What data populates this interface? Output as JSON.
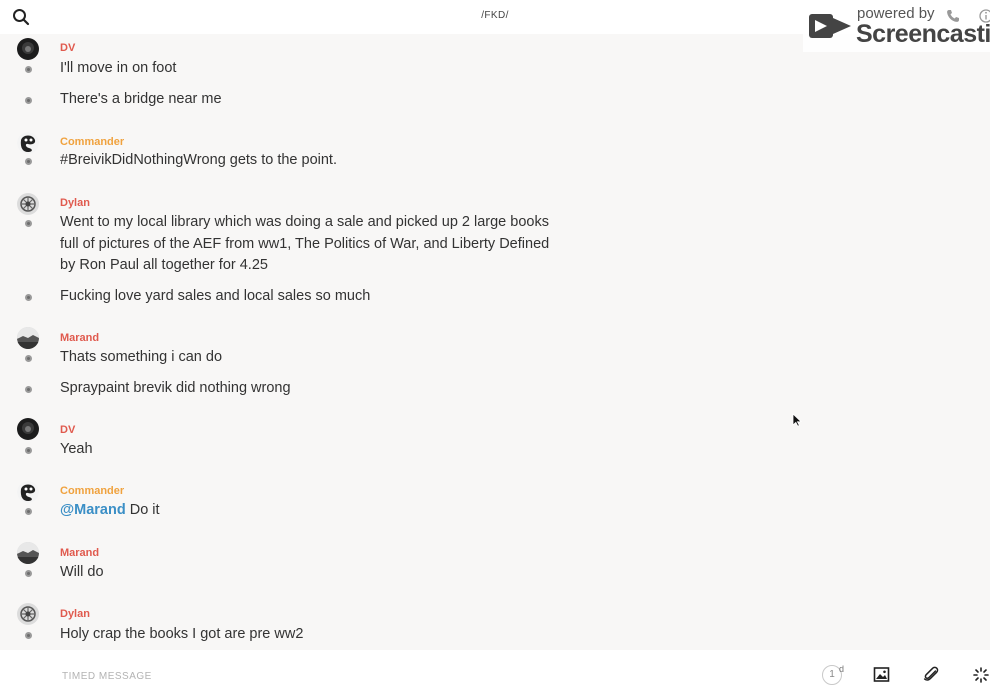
{
  "header": {
    "channel_title": "/FKD/"
  },
  "watermark": {
    "powered_label": "powered by",
    "brand": "Screencastify"
  },
  "colors": {
    "dv": "#e05a4e",
    "commander": "#f0a23e",
    "dylan": "#e05a4e",
    "marand": "#e05a4e",
    "mention": "#3b8fc6"
  },
  "messages": [
    {
      "author": "DV",
      "lines": [
        "I'll move in on foot",
        "There's a bridge near me"
      ]
    },
    {
      "author": "Commander",
      "lines": [
        "#BreivikDidNothingWrong gets to the point."
      ]
    },
    {
      "author": "Dylan",
      "lines": [
        "Went to my local library which was doing a sale and picked up 2 large books full of pictures of the AEF from ww1, The Politics of War, and Liberty Defined by Ron Paul all together for 4.25",
        "Fucking love yard sales and local sales so much"
      ]
    },
    {
      "author": "Marand",
      "lines": [
        "Thats something i can do",
        "Spraypaint brevik did nothing wrong"
      ]
    },
    {
      "author": "DV",
      "lines": [
        "Yeah"
      ]
    },
    {
      "author": "Commander",
      "mention": "@Marand",
      "lines": [
        "Do it"
      ]
    },
    {
      "author": "Marand",
      "lines": [
        "Will do"
      ]
    },
    {
      "author": "Dylan",
      "lines": [
        "Holy crap the books I got are pre ww2"
      ]
    }
  ],
  "composer": {
    "placeholder": "TIMED MESSAGE",
    "timer_value": "1",
    "timer_unit": "d"
  }
}
